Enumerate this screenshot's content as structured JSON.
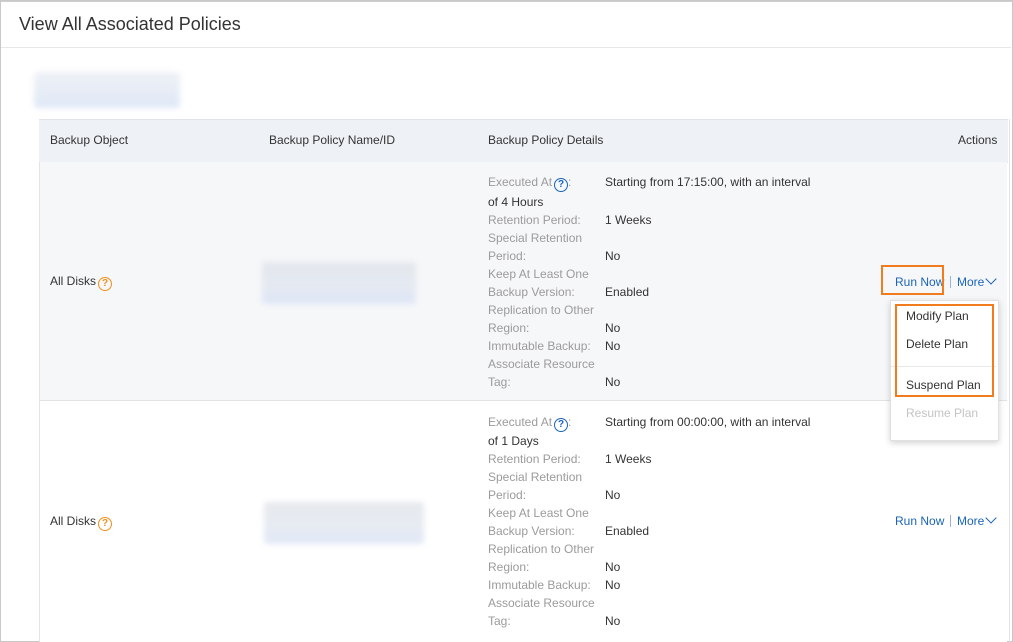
{
  "title": "View All Associated Policies",
  "table": {
    "headers": [
      "Backup Object",
      "Backup Policy Name/ID",
      "Backup Policy Details",
      "Actions"
    ],
    "rows": [
      {
        "object": "All Disks",
        "details": {
          "executed_label": "Executed At",
          "executed_value": "Starting from 17:15:00, with an interval",
          "executed_wrap": "of 4 Hours",
          "retention_label": "Retention Period:",
          "retention_value": "1 Weeks",
          "special_label_1": "Special Retention",
          "special_label_2": "Period:",
          "special_value": "No",
          "keep_label_1": "Keep At Least One",
          "keep_label_2": "Backup Version:",
          "keep_value": "Enabled",
          "repl_label_1": "Replication to Other",
          "repl_label_2": "Region:",
          "repl_value": "No",
          "immutable_label": "Immutable Backup:",
          "immutable_value": "No",
          "tag_label_1": "Associate Resource",
          "tag_label_2": "Tag:",
          "tag_value": "No"
        },
        "actions": {
          "run_now": "Run Now",
          "more": "More"
        }
      },
      {
        "object": "All Disks",
        "details": {
          "executed_label": "Executed At",
          "executed_value": "Starting from 00:00:00, with an interval",
          "executed_wrap": "of 1 Days",
          "retention_label": "Retention Period:",
          "retention_value": "1 Weeks",
          "special_label_1": "Special Retention",
          "special_label_2": "Period:",
          "special_value": "No",
          "keep_label_1": "Keep At Least One",
          "keep_label_2": "Backup Version:",
          "keep_value": "Enabled",
          "repl_label_1": "Replication to Other",
          "repl_label_2": "Region:",
          "repl_value": "No",
          "immutable_label": "Immutable Backup:",
          "immutable_value": "No",
          "tag_label_1": "Associate Resource",
          "tag_label_2": "Tag:",
          "tag_value": "No"
        },
        "actions": {
          "run_now": "Run Now",
          "more": "More"
        }
      }
    ]
  },
  "more_menu": {
    "items": [
      "Modify Plan",
      "Delete Plan",
      "Suspend Plan",
      "Resume Plan"
    ]
  },
  "colors": {
    "link": "#1b64b8",
    "highlight": "#f07c1e",
    "help_icon": "#f0901e",
    "header_bg": "#eef1f5"
  },
  "icons": {
    "help": "question-circle-icon",
    "chevron": "chevron-down-icon"
  }
}
